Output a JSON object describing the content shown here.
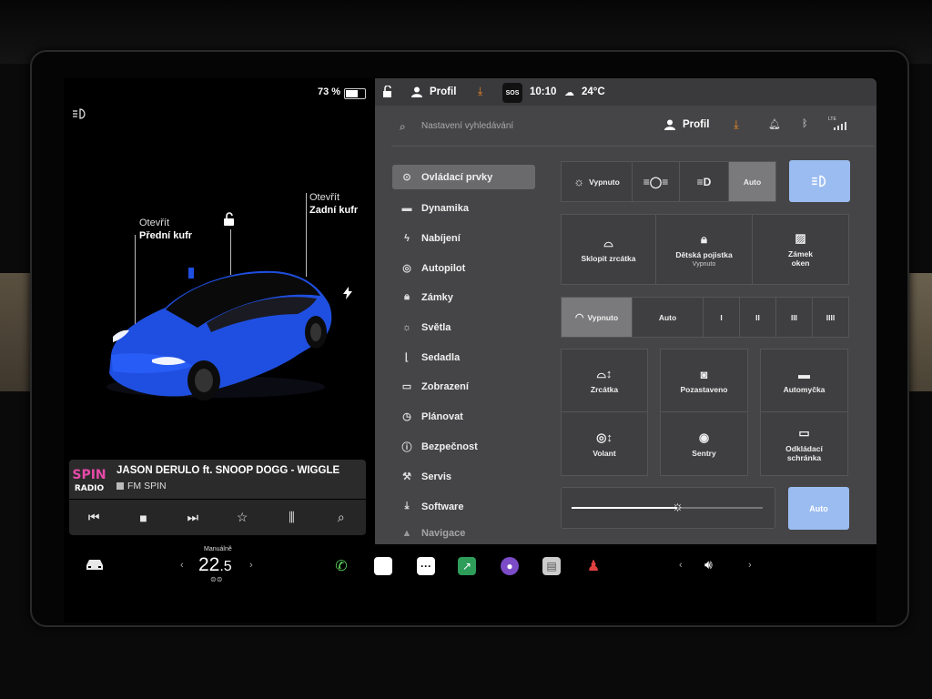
{
  "status": {
    "battery": "73 %",
    "profile": "Profil",
    "sos": "SOS",
    "time": "10:10",
    "temperature": "24°C"
  },
  "car_view": {
    "frunk_line1": "Otevřít",
    "frunk_line2": "Přední kufr",
    "trunk_line1": "Otevřít",
    "trunk_line2": "Zadní kufr"
  },
  "media": {
    "logo_text": "SPIN RADIO",
    "track": "JASON DERULO ft. SNOOP DOGG - WIGGLE",
    "station": "FM SPIN"
  },
  "settings_header": {
    "search_placeholder": "Nastavení vyhledávání",
    "profile": "Profil",
    "lte": "LTE"
  },
  "menu": [
    {
      "label": "Ovládací prvky",
      "icon": "toggle-icon"
    },
    {
      "label": "Dynamika",
      "icon": "car-icon"
    },
    {
      "label": "Nabíjení",
      "icon": "bolt-icon"
    },
    {
      "label": "Autopilot",
      "icon": "steering-wheel-icon"
    },
    {
      "label": "Zámky",
      "icon": "lock-icon"
    },
    {
      "label": "Světla",
      "icon": "light-icon"
    },
    {
      "label": "Sedadla",
      "icon": "seat-icon"
    },
    {
      "label": "Zobrazení",
      "icon": "display-icon"
    },
    {
      "label": "Plánovat",
      "icon": "clock-icon"
    },
    {
      "label": "Bezpečnost",
      "icon": "alert-icon"
    },
    {
      "label": "Servis",
      "icon": "wrench-icon"
    },
    {
      "label": "Software",
      "icon": "download-icon"
    },
    {
      "label": "Navigace",
      "icon": "navigation-icon"
    }
  ],
  "lights": {
    "off": "Vypnuto",
    "auto": "Auto"
  },
  "tiles_row1": {
    "mirrors": "Sklopit zrcátka",
    "child_lock": "Dětská pojistka",
    "child_lock_sub": "Vypnuto",
    "window_lock": "Zámek oken"
  },
  "wipers": {
    "off": "Vypnuto",
    "auto": "Auto",
    "s1": "I",
    "s2": "II",
    "s3": "III",
    "s4": "IIII"
  },
  "tiles_row2": {
    "mirrors": "Zrcátka",
    "dashcam": "Pozastaveno",
    "carwash": "Automyčka",
    "steering": "Volant",
    "sentry": "Sentry",
    "glovebox": "Odkládací schránka"
  },
  "brightness": {
    "auto": "Auto",
    "level": 0.55
  },
  "climate": {
    "mode": "Manuálně",
    "temp_int": "22",
    "temp_dec": ".5"
  },
  "colors": {
    "car_blue": "#1f4fe0",
    "accent_blue": "#9bbcf0",
    "panel": "#454547",
    "download_orange": "#f08a24"
  }
}
